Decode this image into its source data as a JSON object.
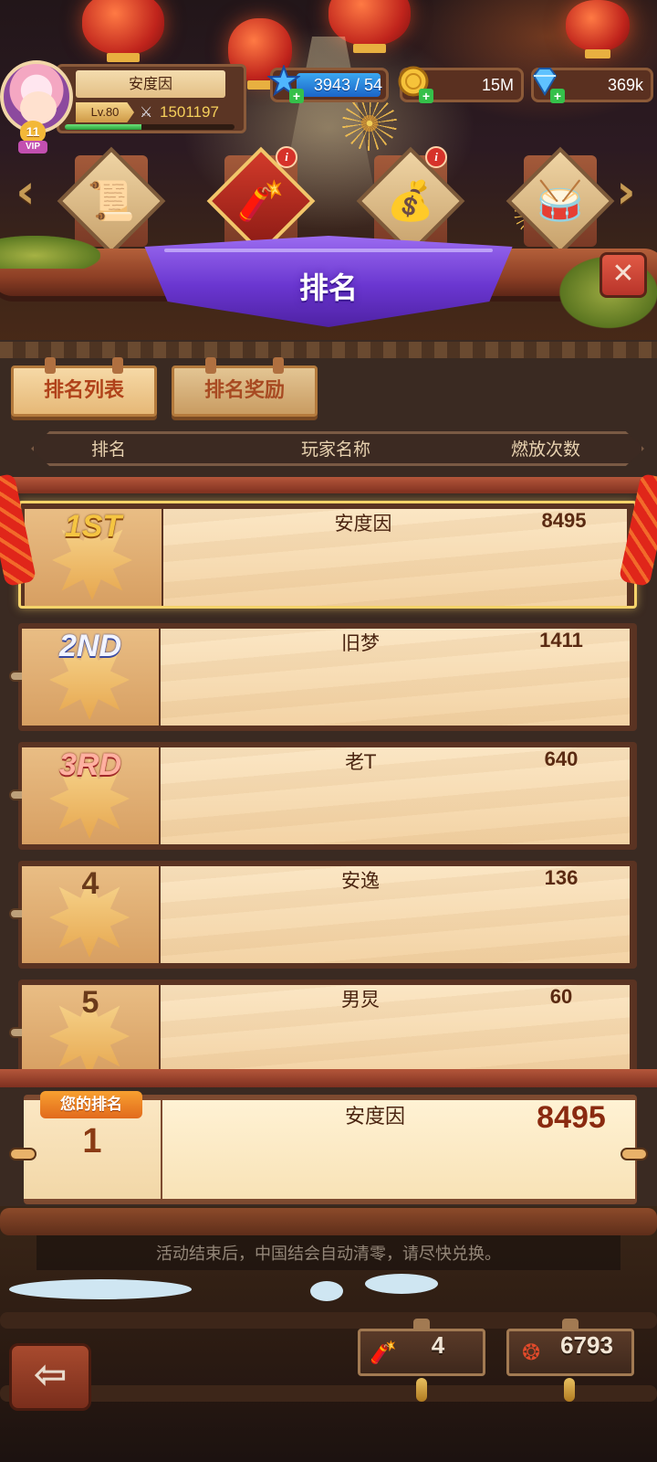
{
  "header": {
    "player_name": "安度因",
    "level": "Lv.80",
    "power": "1501197",
    "vip_level": "11",
    "vip_label": "VIP",
    "xp_fraction": 0.45,
    "currencies": {
      "energy": "3943 / 54",
      "gold": "15M",
      "gems": "369k"
    }
  },
  "events": [
    {
      "icon": "scroll-icon",
      "active": false,
      "info": false
    },
    {
      "icon": "firecracker-icon",
      "active": true,
      "info": true
    },
    {
      "icon": "treasure-bag-icon",
      "active": false,
      "info": true
    },
    {
      "icon": "lion-drum-icon",
      "active": false,
      "info": false
    }
  ],
  "title": "排名",
  "tabs": {
    "ranking_list": "排名列表",
    "ranking_rewards": "排名奖励"
  },
  "columns": {
    "rank": "排名",
    "player_name": "玩家名称",
    "count": "燃放次数"
  },
  "rows": [
    {
      "rank_label": "1ST",
      "name": "安度因",
      "count": "8495"
    },
    {
      "rank_label": "2ND",
      "name": "旧梦",
      "count": "1411"
    },
    {
      "rank_label": "3RD",
      "name": "老T",
      "count": "640"
    },
    {
      "rank_label": "4",
      "name": "安逸",
      "count": "136"
    },
    {
      "rank_label": "5",
      "name": "男炅",
      "count": "60"
    }
  ],
  "my_rank": {
    "tag": "您的排名",
    "rank": "1",
    "name": "安度因",
    "count": "8495"
  },
  "notice": "活动结束后，中国结会自动清零，请尽快兑换。",
  "footer": {
    "firecracker_count": "4",
    "knot_count": "6793"
  },
  "colors": {
    "title_banner": "#6a36d0",
    "tab_text": "#b0421a",
    "rank_gold": "#f5c542",
    "my_rank_tag": "#e26a1c"
  }
}
